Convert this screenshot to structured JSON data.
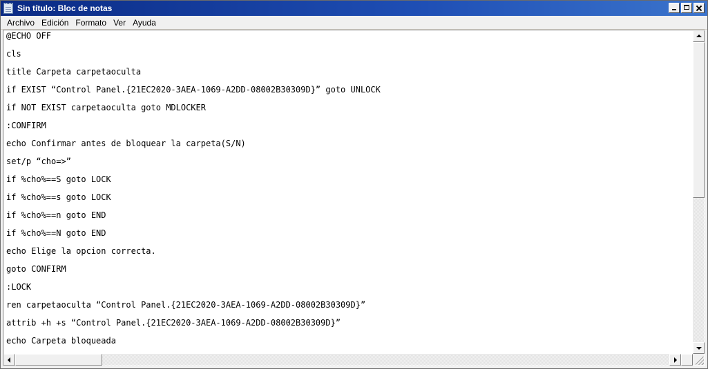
{
  "window": {
    "title": "Sin título: Bloc de notas",
    "app_icon": "notepad-icon"
  },
  "menu": {
    "items": [
      {
        "label": "Archivo"
      },
      {
        "label": "Edición"
      },
      {
        "label": "Formato"
      },
      {
        "label": "Ver"
      },
      {
        "label": "Ayuda"
      }
    ]
  },
  "editor": {
    "lines": [
      "@ECHO OFF",
      "cls",
      "title Carpeta carpetaoculta",
      "if EXIST “Control Panel.{21EC2020-3AEA-1069-A2DD-08002B30309D}” goto UNLOCK",
      "if NOT EXIST carpetaoculta goto MDLOCKER",
      ":CONFIRM",
      "echo Confirmar antes de bloquear la carpeta(S/N)",
      "set/p “cho=>”",
      "if %cho%==S goto LOCK",
      "if %cho%==s goto LOCK",
      "if %cho%==n goto END",
      "if %cho%==N goto END",
      "echo Elige la opcion correcta.",
      "goto CONFIRM",
      ":LOCK",
      "ren carpetaoculta “Control Panel.{21EC2020-3AEA-1069-A2DD-08002B30309D}”",
      "attrib +h +s “Control Panel.{21EC2020-3AEA-1069-A2DD-08002B30309D}”",
      "echo Carpeta bloqueada"
    ]
  },
  "colors": {
    "titlebar": "#1f4fb5",
    "window_bg": "#f0f0f0",
    "editor_bg": "#ffffff"
  }
}
